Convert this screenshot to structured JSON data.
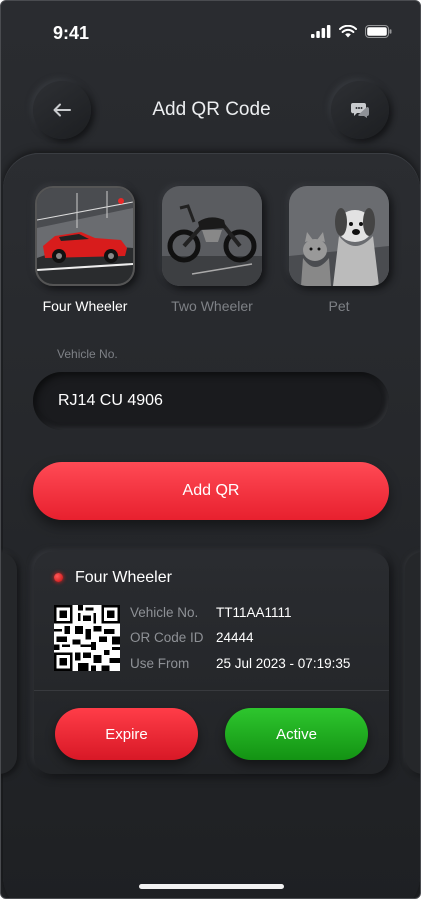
{
  "status_bar": {
    "time": "9:41"
  },
  "header": {
    "title": "Add QR Code"
  },
  "categories": [
    {
      "label": "Four Wheeler",
      "selected": true
    },
    {
      "label": "Two Wheeler",
      "selected": false
    },
    {
      "label": "Pet",
      "selected": false
    }
  ],
  "form": {
    "vehicle_label": "Vehicle No.",
    "vehicle_value": "RJ14 CU 4906",
    "submit_label": "Add QR"
  },
  "qr_card": {
    "title": "Four Wheeler",
    "rows": [
      {
        "label": "Vehicle No.",
        "value": "TT11AA1111"
      },
      {
        "label": "OR Code ID",
        "value": "24444"
      },
      {
        "label": "Use From",
        "value": "25 Jul 2023 - 07:19:35"
      }
    ],
    "expire_label": "Expire",
    "active_label": "Active"
  },
  "colors": {
    "accent_red": "#ff3d48",
    "accent_green": "#1fae1f",
    "background": "#232528"
  },
  "icons": [
    "back-arrow-icon",
    "chat-bubble-icon",
    "signal-icon",
    "wifi-icon",
    "battery-icon",
    "qr-code-icon"
  ]
}
